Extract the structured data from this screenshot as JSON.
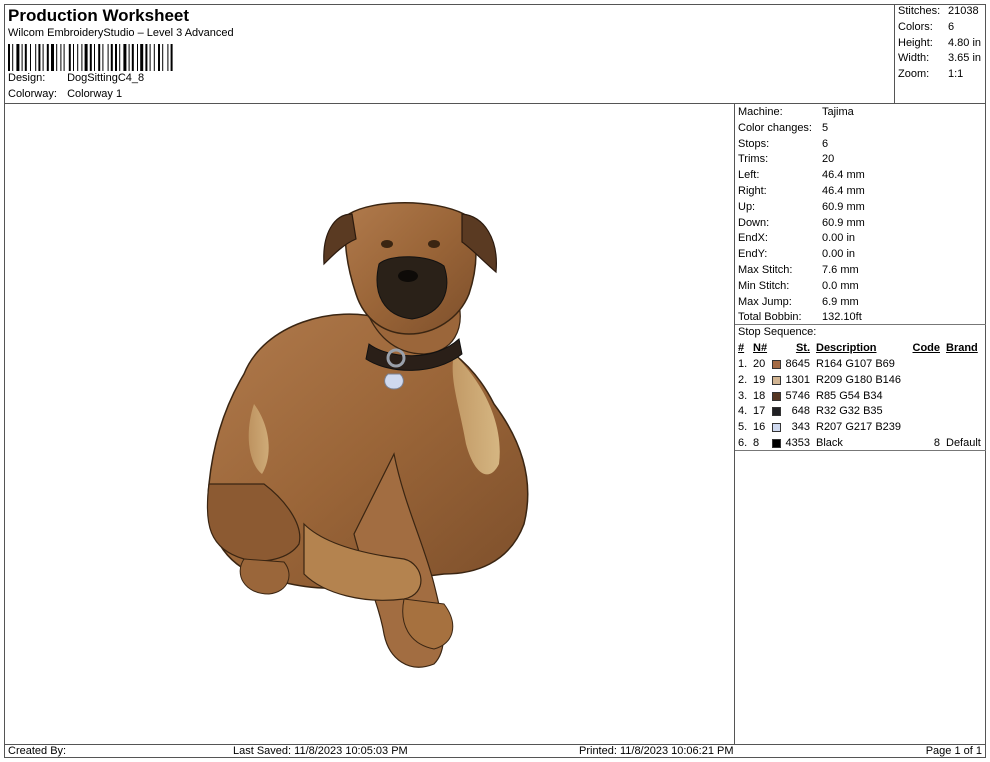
{
  "header": {
    "title": "Production Worksheet",
    "subtitle": "Wilcom EmbroideryStudio – Level 3 Advanced",
    "design_label": "Design:",
    "design_value": "DogSittingC4_8",
    "colorway_label": "Colorway:",
    "colorway_value": "Colorway 1"
  },
  "summary": [
    {
      "label": "Stitches:",
      "value": "21038"
    },
    {
      "label": "Colors:",
      "value": "6"
    },
    {
      "label": "Height:",
      "value": "4.80 in"
    },
    {
      "label": "Width:",
      "value": "3.65 in"
    },
    {
      "label": "Zoom:",
      "value": "1:1"
    }
  ],
  "machine_info": [
    {
      "label": "Machine:",
      "value": "Tajima"
    },
    {
      "label": "Color changes:",
      "value": "5"
    },
    {
      "label": "Stops:",
      "value": "6"
    },
    {
      "label": "Trims:",
      "value": "20"
    },
    {
      "label": "Left:",
      "value": "46.4 mm"
    },
    {
      "label": "Right:",
      "value": "46.4 mm"
    },
    {
      "label": "Up:",
      "value": "60.9 mm"
    },
    {
      "label": "Down:",
      "value": "60.9 mm"
    },
    {
      "label": "EndX:",
      "value": "0.00 in"
    },
    {
      "label": "EndY:",
      "value": "0.00 in"
    },
    {
      "label": "Max Stitch:",
      "value": "7.6 mm"
    },
    {
      "label": "Min Stitch:",
      "value": "0.0 mm"
    },
    {
      "label": "Max Jump:",
      "value": "6.9 mm"
    },
    {
      "label": "Total Bobbin:",
      "value": "132.10ft"
    }
  ],
  "stop_sequence": {
    "title": "Stop Sequence:",
    "headers": {
      "num": "#",
      "n": "N#",
      "st": "St.",
      "desc": "Description",
      "code": "Code",
      "brand": "Brand"
    },
    "rows": [
      {
        "idx": "1.",
        "n": "20",
        "color": "#A46B45",
        "st": "8645",
        "desc": "R164 G107 B69",
        "code": "",
        "brand": ""
      },
      {
        "idx": "2.",
        "n": "19",
        "color": "#D1B492",
        "st": "1301",
        "desc": "R209 G180 B146",
        "code": "",
        "brand": ""
      },
      {
        "idx": "3.",
        "n": "18",
        "color": "#553622",
        "st": "5746",
        "desc": "R85 G54 B34",
        "code": "",
        "brand": ""
      },
      {
        "idx": "4.",
        "n": "17",
        "color": "#202023",
        "st": "648",
        "desc": "R32 G32 B35",
        "code": "",
        "brand": ""
      },
      {
        "idx": "5.",
        "n": "16",
        "color": "#CFD9EF",
        "st": "343",
        "desc": "R207 G217 B239",
        "code": "",
        "brand": ""
      },
      {
        "idx": "6.",
        "n": "8",
        "color": "#000000",
        "st": "4353",
        "desc": "Black",
        "code": "8",
        "brand": "Default"
      }
    ]
  },
  "footer": {
    "created_by": "Created By:",
    "last_saved": "Last Saved: 11/8/2023 10:05:03 PM",
    "printed": "Printed: 11/8/2023 10:06:21 PM",
    "page": "Page 1 of 1"
  }
}
